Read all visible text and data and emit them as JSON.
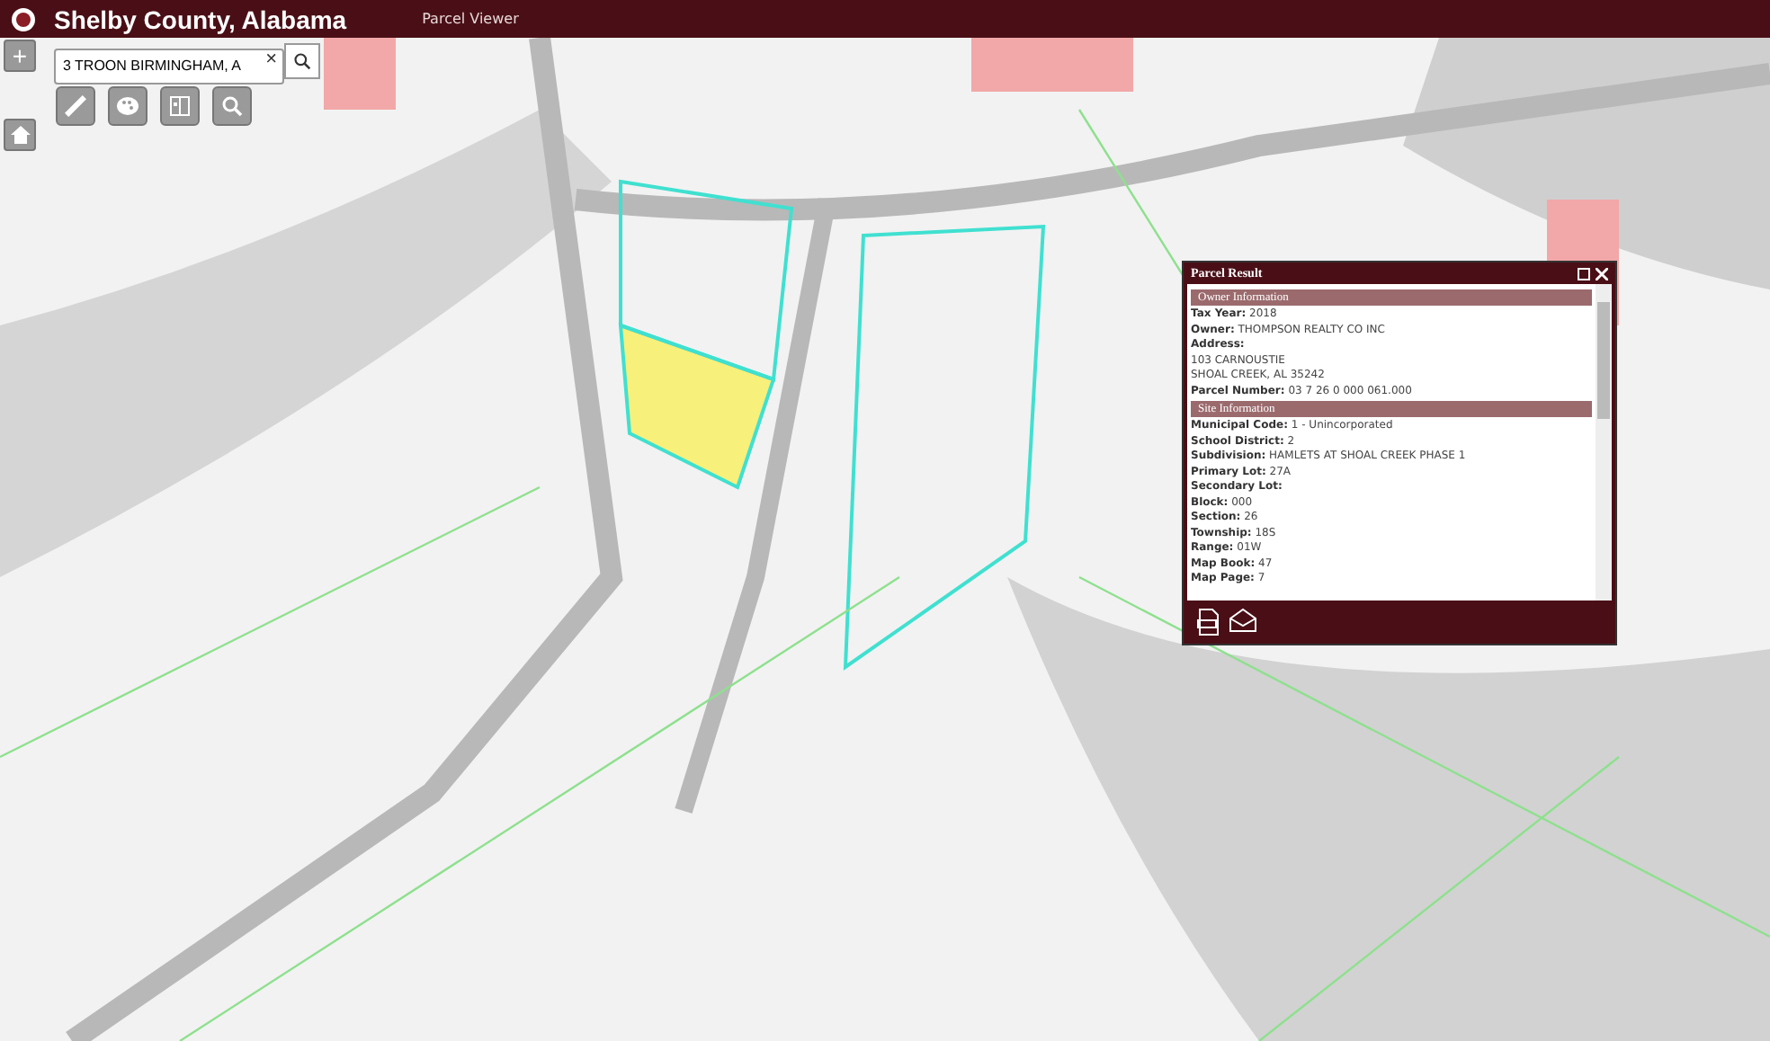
{
  "header": {
    "title": "Shelby County, Alabama",
    "subtitle": "Parcel Viewer"
  },
  "zoom_controls": [
    {
      "label": "+",
      "kind": "zoom"
    },
    {
      "kind": "home"
    }
  ],
  "search": {
    "value": "3 TROON BIRMINGHAM, A",
    "clear": "×"
  },
  "tools": [
    {
      "kind": "ruler"
    },
    {
      "kind": "palette"
    },
    {
      "kind": "layers"
    },
    {
      "kind": "search"
    }
  ],
  "popup": {
    "title": "Parcel Result",
    "sections": [
      {
        "heading": "Owner Information",
        "rows": [
          {
            "kind": "field",
            "label": "Tax Year:",
            "value": "2018"
          },
          {
            "kind": "field",
            "label": "Owner:",
            "value": "THOMPSON REALTY CO INC"
          },
          {
            "kind": "field",
            "label": "Address:"
          },
          {
            "kind": "line",
            "value": "103 CARNOUSTIE"
          },
          {
            "kind": "line",
            "value": "SHOAL CREEK, AL 35242"
          },
          {
            "kind": "field",
            "label": "Parcel Number:",
            "value": "03 7 26 0 000 061.000"
          }
        ]
      },
      {
        "heading": "Site Information",
        "rows": [
          {
            "kind": "field",
            "label": "Municipal Code:",
            "value": "1 - Unincorporated"
          },
          {
            "kind": "field",
            "label": "School District:",
            "value": "2"
          },
          {
            "kind": "field",
            "label": "Subdivision:",
            "value": "HAMLETS AT SHOAL CREEK PHASE 1"
          },
          {
            "kind": "field",
            "label": "Primary Lot:",
            "value": "27A"
          },
          {
            "kind": "field",
            "label": "Secondary Lot:"
          },
          {
            "kind": "field",
            "label": "Block:",
            "value": "000"
          },
          {
            "kind": "field",
            "label": "Section:",
            "value": "26"
          },
          {
            "kind": "field",
            "label": "Township:",
            "value": "18S"
          },
          {
            "kind": "field",
            "label": "Range:",
            "value": "01W"
          },
          {
            "kind": "field",
            "label": "Map Book:",
            "value": "47"
          },
          {
            "kind": "field",
            "label": "Map Page:",
            "value": "7"
          }
        ]
      }
    ],
    "footer_actions": [
      {
        "kind": "document"
      },
      {
        "kind": "mail"
      }
    ]
  }
}
